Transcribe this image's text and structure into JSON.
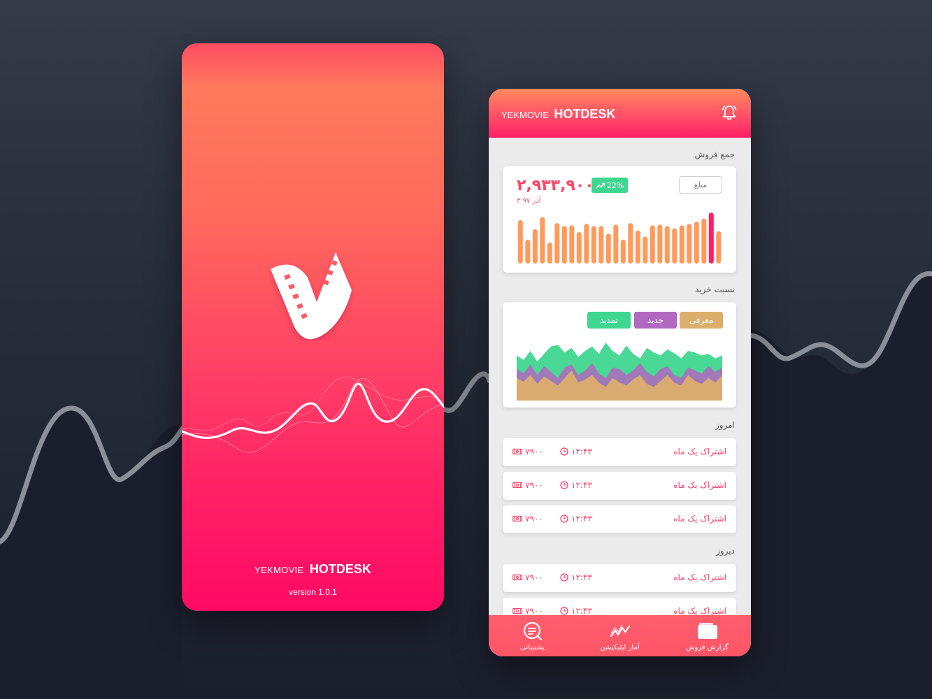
{
  "colors": {
    "accent": "#ff3d6a",
    "bar": "#ff9a5c",
    "bar_highlight": "#ff1f66",
    "green": "#3fd690",
    "purple": "#b068c0",
    "tan": "#dcae6c"
  },
  "splash": {
    "brand_prefix": "YEKMOVIE",
    "brand_main": "HOTDESK",
    "version": "version 1.0,1",
    "logo_icon": "film-strip-check-logo"
  },
  "dashboard": {
    "brand_prefix": "YEKMOVIE",
    "brand_main": "HOTDESK",
    "notification_icon": "bell-icon",
    "sales": {
      "section_title": "جمع فروش",
      "amount": "۲,۹۳۳,۹۰۰",
      "growth": "22%",
      "date": "۳ آذر ۹۷",
      "metric_button": "مبلغ",
      "bar_values": [
        58,
        32,
        46,
        62,
        28,
        54,
        50,
        51,
        42,
        53,
        50,
        50,
        40,
        52,
        32,
        54,
        44,
        36,
        51,
        52,
        50,
        47,
        51,
        53,
        56,
        60,
        68,
        43
      ],
      "highlight_index": 26
    },
    "ratio": {
      "section_title": "نسبت خرید",
      "legend": [
        {
          "label": "معرفی",
          "color": "#dcae6c"
        },
        {
          "label": "جدید",
          "color": "#b068c0"
        },
        {
          "label": "تمدید",
          "color": "#3fd690"
        }
      ],
      "series": {
        "green": [
          60,
          54,
          66,
          52,
          62,
          72,
          74,
          64,
          70,
          58,
          66,
          72,
          62,
          77,
          66,
          60,
          73,
          62,
          56,
          70,
          64,
          60,
          68,
          63,
          56,
          66,
          64,
          60,
          62,
          56,
          60
        ],
        "purple": [
          42,
          36,
          48,
          34,
          46,
          38,
          30,
          44,
          48,
          34,
          40,
          50,
          36,
          30,
          44,
          42,
          34,
          40,
          50,
          38,
          32,
          42,
          46,
          34,
          30,
          44,
          40,
          36,
          46,
          38,
          44
        ],
        "tan": [
          30,
          25,
          34,
          22,
          32,
          26,
          20,
          30,
          40,
          24,
          28,
          34,
          24,
          18,
          30,
          24,
          20,
          28,
          34,
          22,
          18,
          26,
          34,
          24,
          20,
          34,
          26,
          22,
          30,
          24,
          34
        ]
      }
    },
    "today": {
      "section_title": "امروز",
      "rows": [
        {
          "title": "اشتراک یک ماه",
          "time": "۱۲:۴۳",
          "price": "۷۹۰۰"
        },
        {
          "title": "اشتراک یک ماه",
          "time": "۱۲:۴۳",
          "price": "۷۹۰۰"
        },
        {
          "title": "اشتراک یک ماه",
          "time": "۱۲:۴۳",
          "price": "۷۹۰۰"
        }
      ]
    },
    "yesterday": {
      "section_title": "دیروز",
      "rows": [
        {
          "title": "اشتراک یک ماه",
          "time": "۱۲:۴۳",
          "price": "۷۹۰۰"
        },
        {
          "title": "اشتراک یک ماه",
          "time": "۱۲:۴۳",
          "price": "۷۹۰۰"
        }
      ]
    },
    "nav": [
      {
        "label": "پشتیبانی",
        "icon": "support-chat-icon"
      },
      {
        "label": "آمار اپلیکیشن",
        "icon": "trend-chart-icon"
      },
      {
        "label": "گزارش فروش",
        "icon": "wallet-icon"
      }
    ]
  }
}
